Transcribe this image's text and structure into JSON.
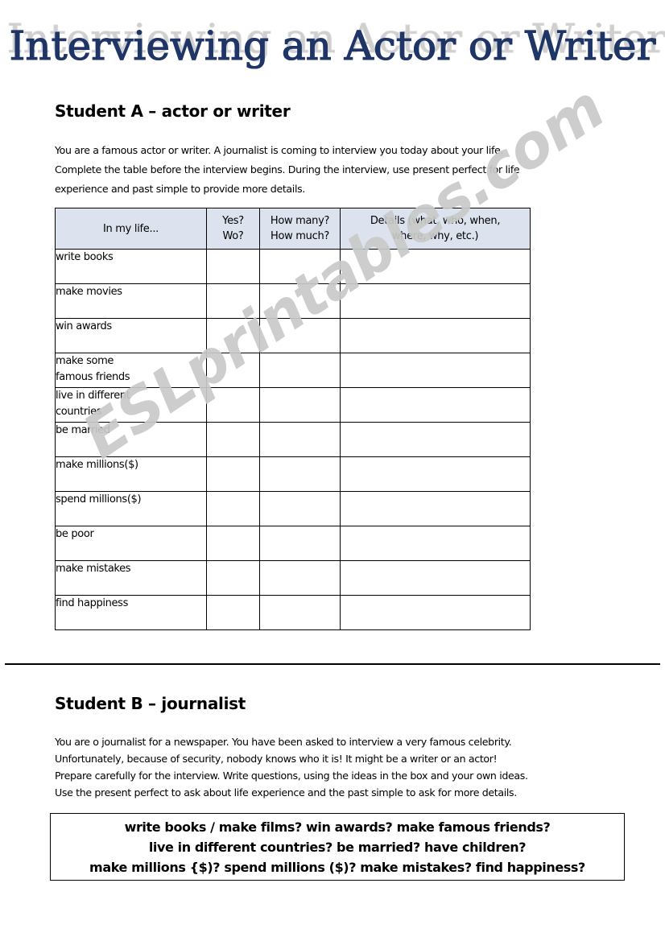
{
  "document": {
    "title": "Interviewing an Actor or Writer",
    "watermark": "ESLprintables.com",
    "colors": {
      "table_header_bg": "#dce3ef",
      "title_fill": "#5c7cb8",
      "title_outline": "#1f3566",
      "title_shadow": "#cfcfcf",
      "watermark": "#c9c9c9",
      "border": "#000000",
      "page_bg": "#ffffff"
    }
  },
  "student_a": {
    "heading": "Student A – actor or writer",
    "paragraph_lines": [
      "You are a famous actor or writer. A journalist is coming to interview you today about your life.",
      "Complete the table before the interview begins. During the interview, use present perfect for life",
      "experience and past simple to provide more details."
    ],
    "table": {
      "columns": [
        {
          "header": "In my life...",
          "lines": [
            "In my life..."
          ]
        },
        {
          "header": "Yes? Wo?",
          "lines": [
            "Yes?",
            "Wo?"
          ]
        },
        {
          "header": "How many? How much?",
          "lines": [
            "How many?",
            "How much?"
          ]
        },
        {
          "header": "Details (what, who, when, where, why, etc.)",
          "lines": [
            "Details (what, who, when,",
            "where, why, etc.)"
          ]
        }
      ],
      "rows": [
        {
          "item": "write books",
          "yes_no": "",
          "how_many": "",
          "details": ""
        },
        {
          "item": "make movies",
          "yes_no": "",
          "how_many": "",
          "details": ""
        },
        {
          "item": "win awards",
          "yes_no": "",
          "how_many": "",
          "details": ""
        },
        {
          "item": "make some\nfamous friends",
          "yes_no": "",
          "how_many": "",
          "details": ""
        },
        {
          "item": "live in different\ncountries",
          "yes_no": "",
          "how_many": "",
          "details": ""
        },
        {
          "item": "be married",
          "yes_no": "",
          "how_many": "",
          "details": ""
        },
        {
          "item": "make millions($)",
          "yes_no": "",
          "how_many": "",
          "details": ""
        },
        {
          "item": "spend millions($)",
          "yes_no": "",
          "how_many": "",
          "details": ""
        },
        {
          "item": "be poor",
          "yes_no": "",
          "how_many": "",
          "details": ""
        },
        {
          "item": "make mistakes",
          "yes_no": "",
          "how_many": "",
          "details": ""
        },
        {
          "item": "find happiness",
          "yes_no": "",
          "how_many": "",
          "details": ""
        }
      ]
    }
  },
  "student_b": {
    "heading": "Student B – journalist",
    "paragraph_lines": [
      "You are o journalist for a newspaper. You have been asked to interview a very famous celebrity.",
      "Unfortunately, because of security, nobody knows who it is! It might be a writer or an actor!",
      "Prepare carefully for the interview. Write questions, using the ideas in the box and your own ideas.",
      "Use the present perfect to ask about life experience and the past simple to ask for more details."
    ],
    "ideas_box_lines": [
      "write books / make films? win awards? make famous friends?",
      "live in different countries? be married? have children?",
      "make millions {$)? spend millions ($)? make mistakes? find happiness?"
    ]
  }
}
